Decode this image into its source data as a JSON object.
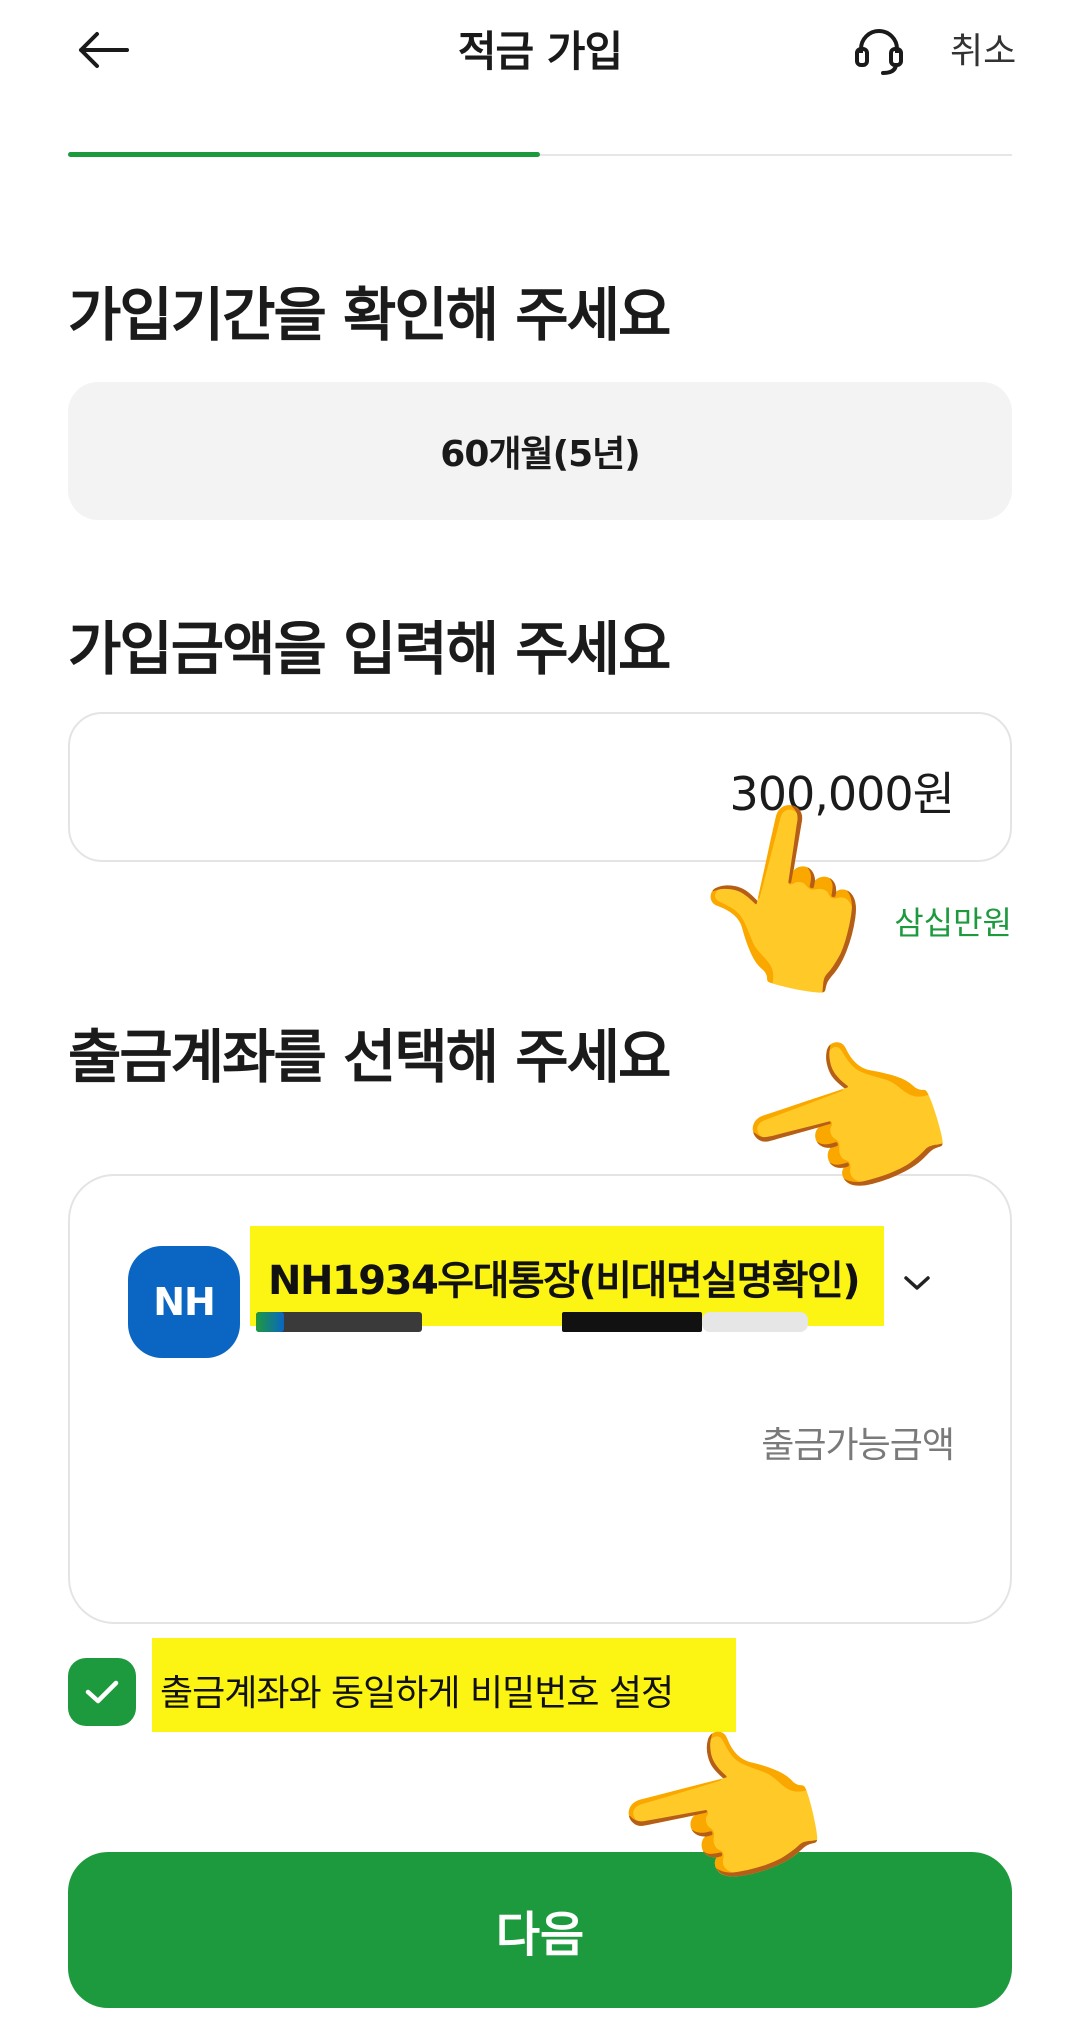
{
  "header": {
    "title": "적금 가입",
    "cancel_label": "취소",
    "back_icon": "arrow-left-icon",
    "support_icon": "headset-icon"
  },
  "progress": {
    "fraction": 0.5
  },
  "period_section": {
    "title": "가입기간을 확인해 주세요",
    "value": "60개월(5년)"
  },
  "amount_section": {
    "title": "가입금액을 입력해 주세요",
    "value": "300,000원",
    "korean_amount": "삼십만원"
  },
  "account_section": {
    "title": "출금계좌를 선택해 주세요",
    "bank_logo_text": "NH",
    "account_name": "NH1934우대통장(비대면실명확인)",
    "available_label": "출금가능금액"
  },
  "password_option": {
    "label": "출금계좌와 동일하게 비밀번호 설정",
    "checked": true
  },
  "next_button": {
    "label": "다음"
  },
  "colors": {
    "accent": "#1e9a3e",
    "highlight": "#fcf514",
    "bank_blue": "#0a66c2"
  },
  "annotations": [
    "pointing-hand-emoji"
  ]
}
